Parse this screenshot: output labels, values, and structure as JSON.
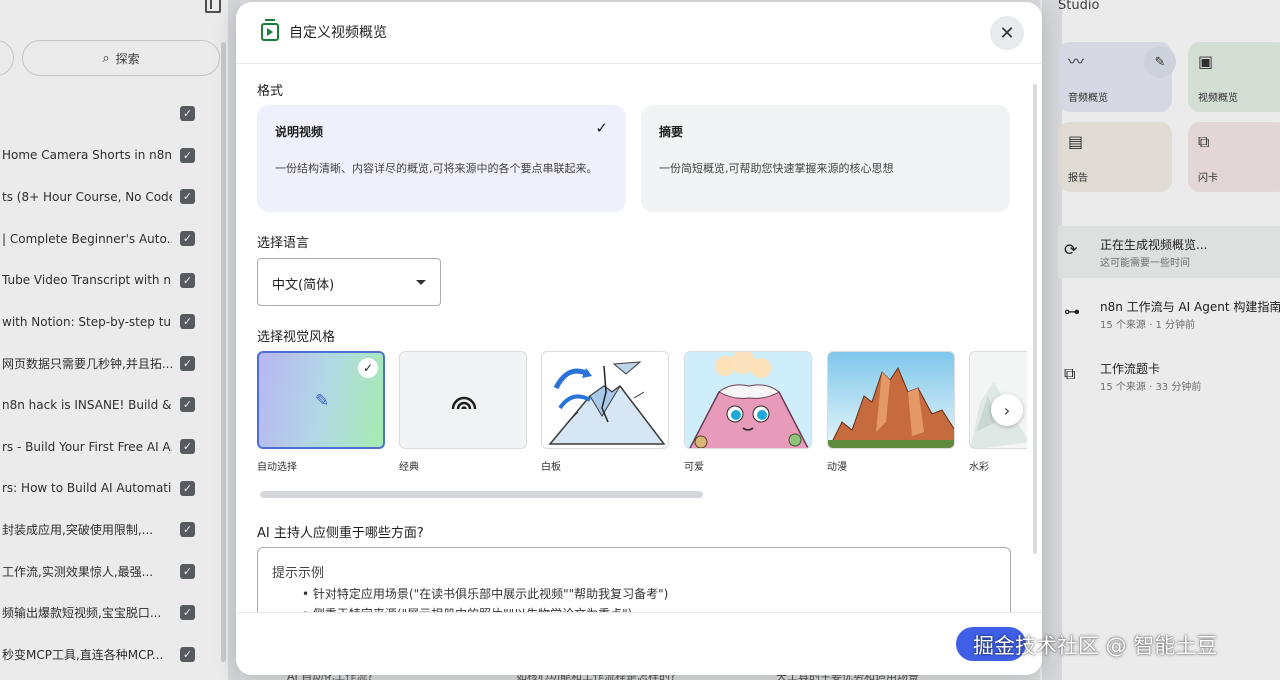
{
  "background": {
    "explore_label": "探索",
    "sources": [
      " Home Camera Shorts in n8n...",
      "ts (8+ Hour Course, No Code)",
      " | Complete Beginner's Auto...",
      "Tube Video Transcript with n8...",
      " with Notion: Step-by-step tu...",
      "网页数据只需要几秒钟,并且拓...",
      "n8n hack is INSANE! Build & ...",
      "rs - Build Your First Free AI A...",
      "rs: How to Build AI Automatio...",
      "封装成应用,突破使用限制,...",
      "工作流,实测效果惊人,最强...",
      "频输出爆款短视频,宝宝脱口...",
      "秒变MCP工具,直连各种MCP..."
    ],
    "check_glyph": "✓",
    "studio": {
      "title": "Studio",
      "cards": {
        "audio": "音频概览",
        "video": "视频概览",
        "report": "报告",
        "flashcards": "闪卡"
      },
      "items": [
        {
          "title": "正在生成视频概览...",
          "subtitle": "这可能需要一些时间"
        },
        {
          "title": "n8n 工作流与 AI Agent 构建指南",
          "subtitle": "15 个来源 · 1 分钟前"
        },
        {
          "title": "工作流题卡",
          "subtitle": "15 个来源 · 33 分钟前"
        }
      ]
    },
    "bottom_texts": [
      "AI 自动化工作流?",
      "如核心功能和工作流程是怎样的?",
      "天工具的主要优势和适用场景"
    ]
  },
  "modal": {
    "title": "自定义视频概览",
    "close_glyph": "✕",
    "format": {
      "label": "格式",
      "options": [
        {
          "name": "说明视频",
          "description": "一份结构清晰、内容详尽的概览,可将来源中的各个要点串联起来。",
          "selected": true
        },
        {
          "name": "摘要",
          "description": "一份简短概览,可帮助您快速掌握来源的核心思想",
          "selected": false
        }
      ],
      "check_glyph": "✓"
    },
    "language": {
      "label": "选择语言",
      "value": "中文(简体)"
    },
    "visual_style": {
      "label": "选择视觉风格",
      "options": [
        "自动选择",
        "经典",
        "白板",
        "可爱",
        "动漫",
        "水彩"
      ],
      "selected": "自动选择",
      "next_glyph": "›",
      "pencil_glyph": "✎"
    },
    "focus": {
      "label": "AI 主持人应侧重于哪些方面?",
      "example_title": "提示示例",
      "examples": [
        "针对特定应用场景(\"在读书俱乐部中展示此视频\"\"帮助我复习备考\")",
        "侧重于特定来源(\"展示相册中的照片\"\"以生物学论文为重点\")"
      ]
    }
  },
  "watermark": "掘金技术社区 @ 智能土豆",
  "colors": {
    "accent": "#3f5fe6",
    "selected_border": "#4f6fd8",
    "video_icon": "#188038",
    "selected_card_bg": "#eef1fb"
  }
}
